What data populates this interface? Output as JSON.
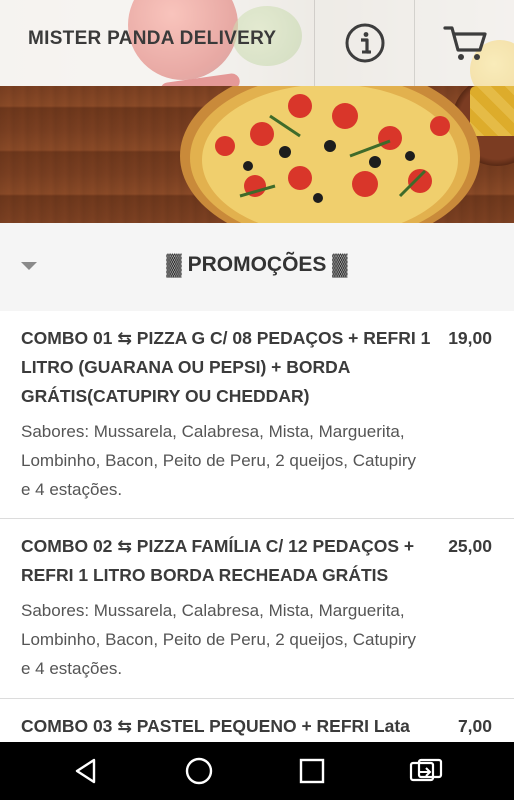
{
  "app": {
    "title": "MISTER PANDA DELIVERY"
  },
  "header": {
    "info_icon": "info-icon",
    "cart_icon": "cart-icon"
  },
  "section": {
    "title": "▓ PROMOÇÕES ▓"
  },
  "items": [
    {
      "name": "COMBO 01 ⇆ PIZZA G C/ 08 PEDAÇOS + REFRI 1 LITRO (GUARANA OU PEPSI) + BORDA GRÁTIS(CATUPIRY OU CHEDDAR)",
      "price": "19,00",
      "desc": "Sabores: Mussarela, Calabresa, Mista, Marguerita, Lombinho, Bacon, Peito de Peru, 2 queijos, Catupiry e 4 estações."
    },
    {
      "name": "COMBO 02 ⇆ PIZZA FAMÍLIA C/ 12 PEDAÇOS + REFRI 1 LITRO BORDA RECHEADA GRÁTIS",
      "price": "25,00",
      "desc": "Sabores: Mussarela, Calabresa, Mista, Marguerita, Lombinho, Bacon, Peito de Peru, 2 queijos, Catupiry e 4 estações."
    },
    {
      "name": "COMBO 03 ⇆ PASTEL PEQUENO + REFRI Lata",
      "price": "7,00",
      "desc": ""
    }
  ],
  "navbar": {
    "back_icon": "back-icon",
    "home_icon": "home-icon",
    "recents_icon": "recents-icon",
    "rotate_icon": "rotate-screen-icon"
  },
  "colors": {
    "text": "#3b3b3b",
    "section_bg": "#f5f5f5",
    "navbar_bg": "#000000"
  }
}
